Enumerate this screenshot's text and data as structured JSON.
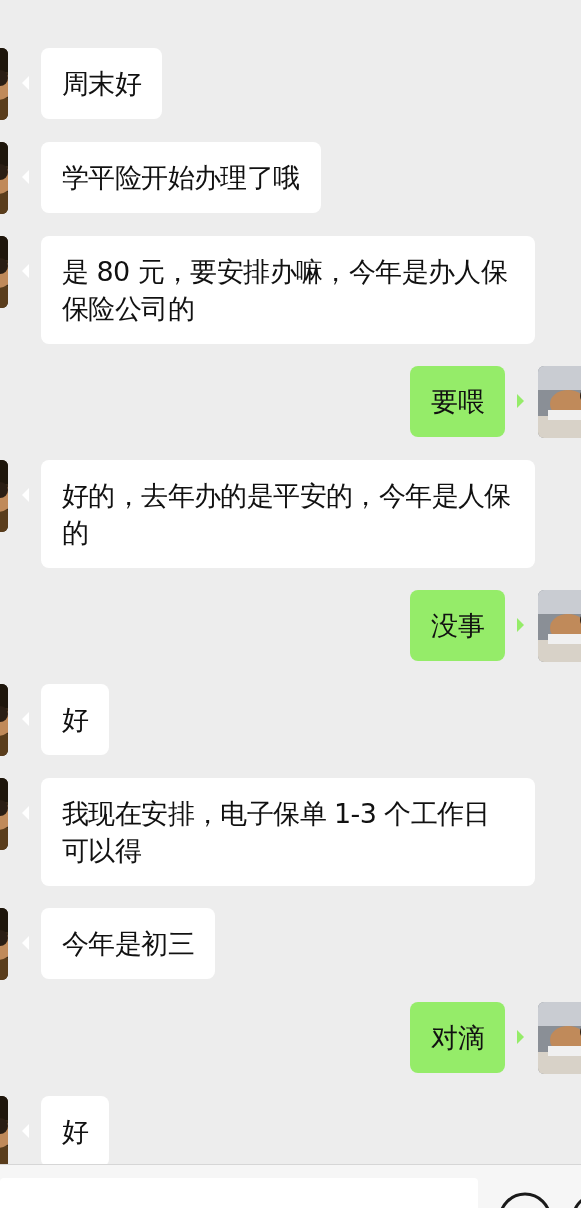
{
  "messages": [
    {
      "kind": "received",
      "text": "周末好"
    },
    {
      "kind": "received",
      "text": "学平险开始办理了哦"
    },
    {
      "kind": "received",
      "text": "是 80 元，要安排办嘛，今年是办人保保险公司的"
    },
    {
      "kind": "sent",
      "text": "要喂"
    },
    {
      "kind": "received",
      "text": "好的，去年办的是平安的，今年是人保的"
    },
    {
      "kind": "sent",
      "text": "没事"
    },
    {
      "kind": "received",
      "text": "好"
    },
    {
      "kind": "received",
      "text": "我现在安排，电子保单 1-3 个工作日可以得"
    },
    {
      "kind": "received",
      "text": "今年是初三"
    },
    {
      "kind": "sent",
      "text": "对滴"
    },
    {
      "kind": "received",
      "text": "好"
    }
  ]
}
